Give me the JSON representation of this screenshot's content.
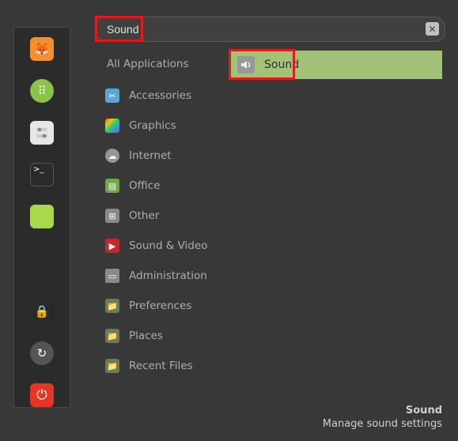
{
  "search": {
    "value": "Sound"
  },
  "sidebar": {
    "firefox": "🦊",
    "grid": "⠿",
    "settings": "⨮",
    "terminal": ">_",
    "files": "",
    "lock": "🔒",
    "logout": "↻",
    "power": "⏻"
  },
  "categories": {
    "all": "All Applications",
    "items": [
      {
        "label": "Accessories"
      },
      {
        "label": "Graphics"
      },
      {
        "label": "Internet"
      },
      {
        "label": "Office"
      },
      {
        "label": "Other"
      },
      {
        "label": "Sound & Video"
      },
      {
        "label": "Administration"
      },
      {
        "label": "Preferences"
      },
      {
        "label": "Places"
      },
      {
        "label": "Recent Files"
      }
    ]
  },
  "results": {
    "items": [
      {
        "label": "Sound"
      }
    ]
  },
  "footer": {
    "title": "Sound",
    "desc": "Manage sound settings"
  }
}
